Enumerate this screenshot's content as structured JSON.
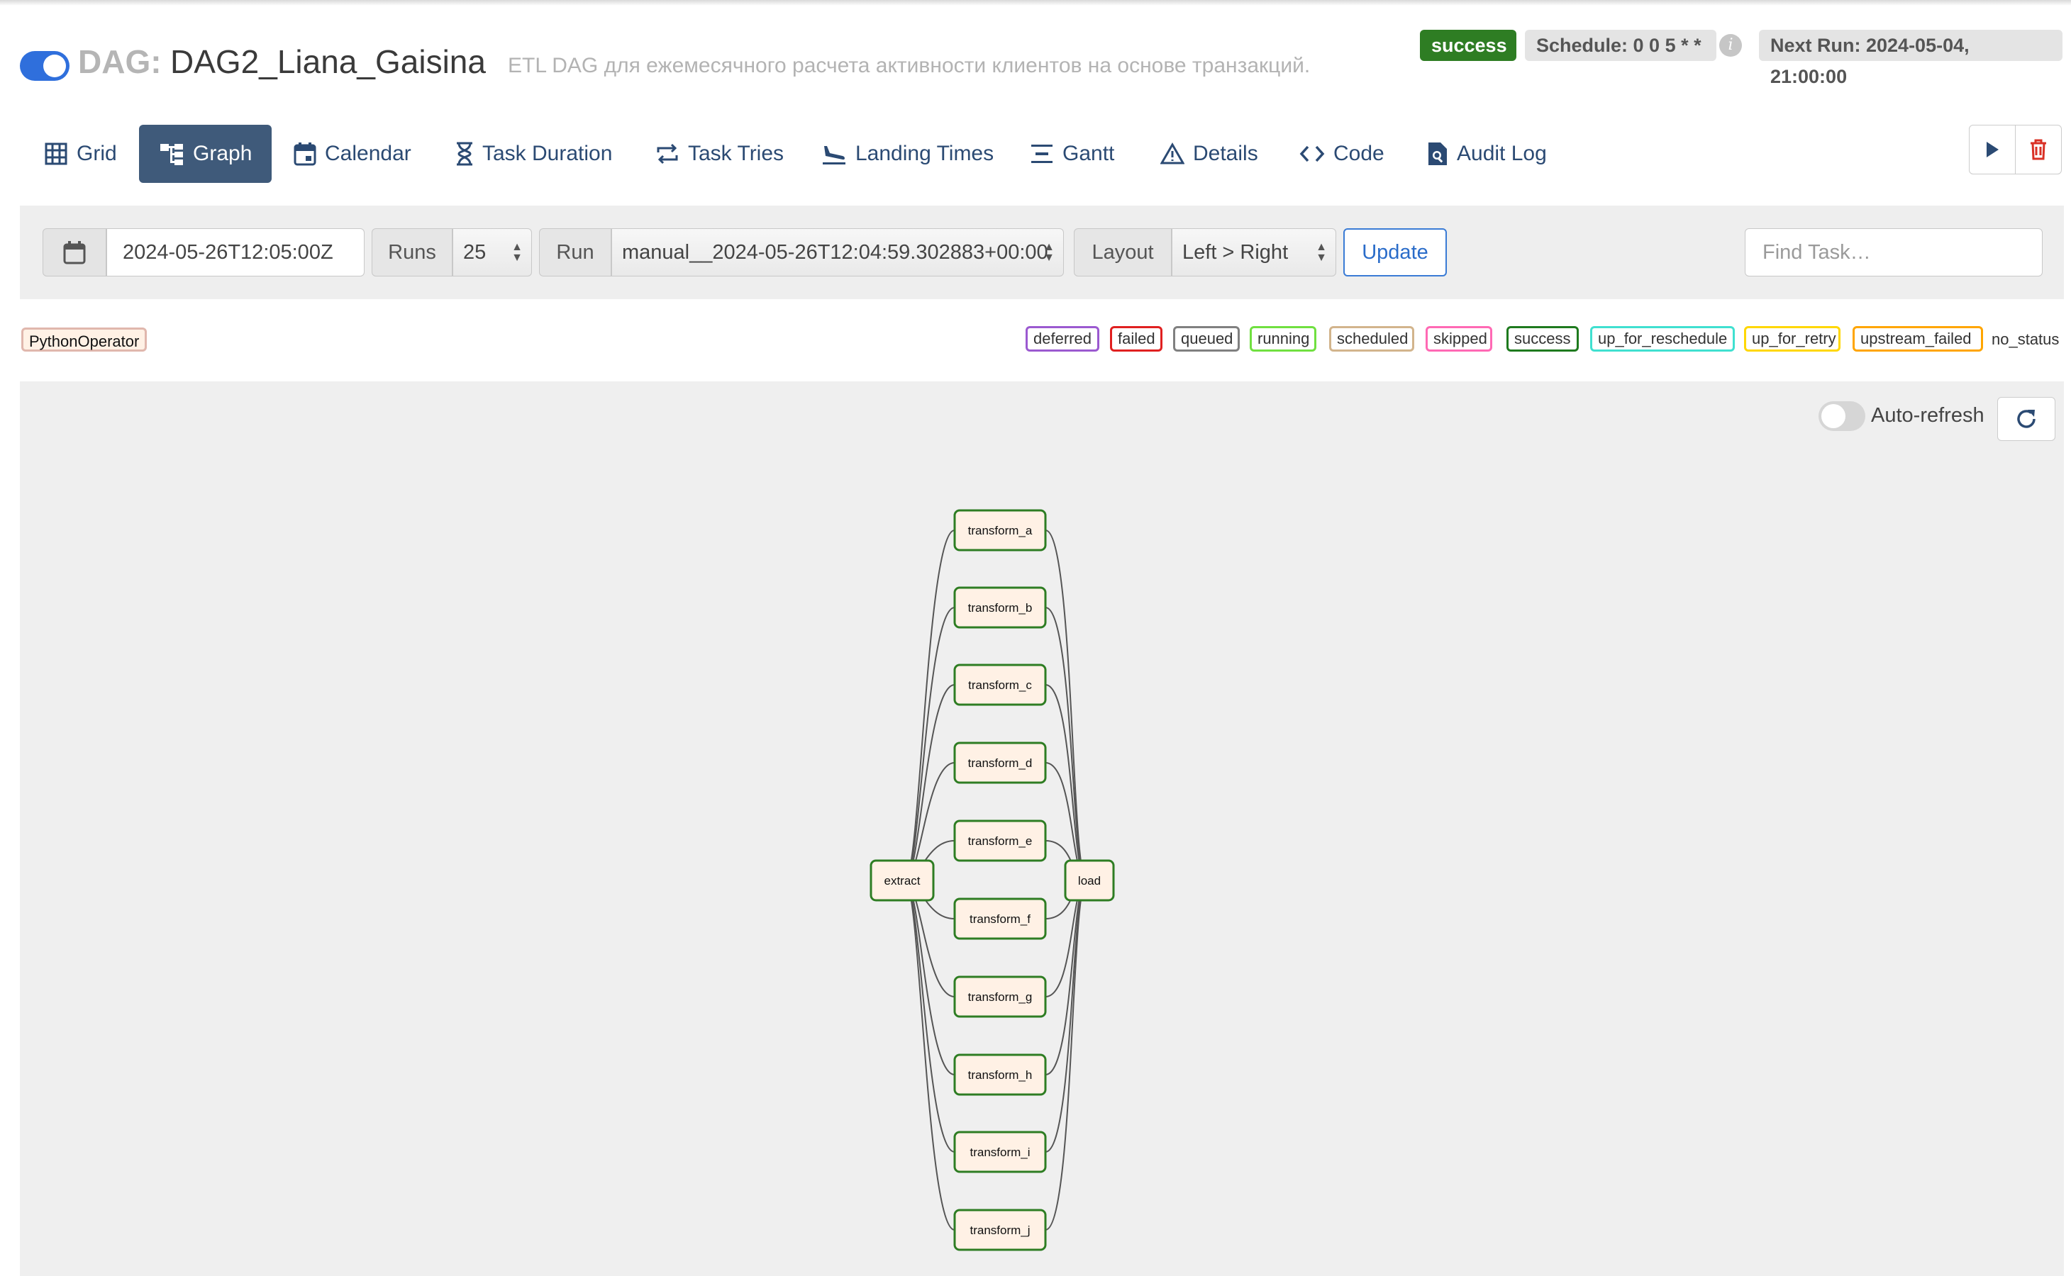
{
  "header": {
    "dag_prefix": "DAG:",
    "dag_id": "DAG2_Liana_Gaisina",
    "description": "ETL DAG для ежемесячного расчета активности клиентов на основе транзакций.",
    "status": "success",
    "schedule": "Schedule: 0 0 5 * *",
    "next_run": "Next Run: 2024-05-04, 21:00:00",
    "paused_toggle_on": true
  },
  "tabs": [
    {
      "label": "Grid",
      "icon": "grid-icon"
    },
    {
      "label": "Graph",
      "icon": "graph-icon",
      "active": true
    },
    {
      "label": "Calendar",
      "icon": "calendar-icon"
    },
    {
      "label": "Task Duration",
      "icon": "hourglass-icon"
    },
    {
      "label": "Task Tries",
      "icon": "retry-icon"
    },
    {
      "label": "Landing Times",
      "icon": "landing-icon"
    },
    {
      "label": "Gantt",
      "icon": "gantt-icon"
    },
    {
      "label": "Details",
      "icon": "warning-icon"
    },
    {
      "label": "Code",
      "icon": "code-icon"
    },
    {
      "label": "Audit Log",
      "icon": "document-search-icon"
    }
  ],
  "actions": {
    "trigger": "play-icon",
    "delete": "trash-icon"
  },
  "filters": {
    "base_date": "2024-05-26T12:05:00Z",
    "runs_label": "Runs",
    "runs_value": "25",
    "run_label": "Run",
    "run_value": "manual__2024-05-26T12:04:59.302883+00:00",
    "layout_label": "Layout",
    "layout_value": "Left > Right",
    "update_label": "Update",
    "find_placeholder": "Find Task…"
  },
  "legend": {
    "operator": "PythonOperator",
    "statuses": [
      {
        "name": "deferred",
        "color": "#9b59d0"
      },
      {
        "name": "failed",
        "color": "#e02020"
      },
      {
        "name": "queued",
        "color": "#808080"
      },
      {
        "name": "running",
        "color": "#70e040"
      },
      {
        "name": "scheduled",
        "color": "#d2b48c"
      },
      {
        "name": "skipped",
        "color": "#ff69b4"
      },
      {
        "name": "success",
        "color": "#1e7a1e"
      },
      {
        "name": "up_for_reschedule",
        "color": "#40e0d0"
      },
      {
        "name": "up_for_retry",
        "color": "#ffd700"
      },
      {
        "name": "upstream_failed",
        "color": "#ffa500"
      }
    ],
    "no_status": "no_status"
  },
  "canvas": {
    "auto_refresh_label": "Auto-refresh",
    "auto_refresh_on": false
  },
  "graph": {
    "source": "extract",
    "sink": "load",
    "middle": [
      "transform_a",
      "transform_b",
      "transform_c",
      "transform_d",
      "transform_e",
      "transform_f",
      "transform_g",
      "transform_h",
      "transform_i",
      "transform_j"
    ],
    "node_border": "#2e7d23",
    "node_fill": "#fff1e5"
  }
}
